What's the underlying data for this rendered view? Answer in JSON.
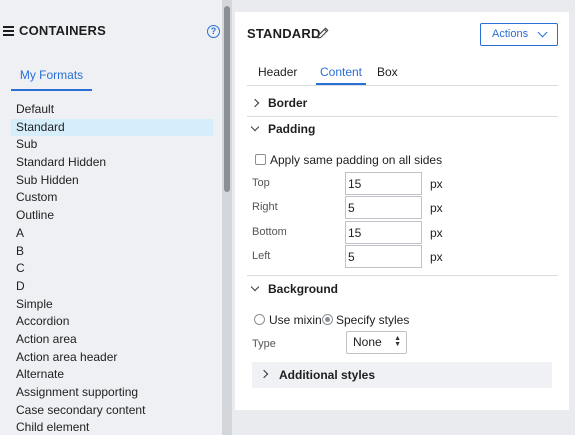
{
  "left_panel": {
    "title": "CONTAINERS",
    "help_icon": "?",
    "tab_label": "My Formats",
    "formats": [
      "Default",
      "Standard",
      "Sub",
      "Standard Hidden",
      "Sub Hidden",
      "Custom",
      "Outline",
      "A",
      "B",
      "C",
      "D",
      "Simple",
      "Accordion",
      "Action area",
      "Action area header",
      "Alternate",
      "Assignment supporting",
      "Case secondary content",
      "Child element"
    ],
    "selected_format": "Standard"
  },
  "detail": {
    "title": "STANDARD",
    "actions_label": "Actions",
    "tabs": [
      "Header",
      "Content",
      "Box"
    ],
    "active_tab": "Content",
    "sections": {
      "border": "Border",
      "padding": "Padding",
      "background": "Background"
    },
    "padding": {
      "same_all_label": "Apply same padding on all sides",
      "same_all_checked": false,
      "rows": [
        {
          "label": "Top",
          "value": "15",
          "unit": "px"
        },
        {
          "label": "Right",
          "value": "5",
          "unit": "px"
        },
        {
          "label": "Bottom",
          "value": "15",
          "unit": "px"
        },
        {
          "label": "Left",
          "value": "5",
          "unit": "px"
        }
      ]
    },
    "background": {
      "option_mixin": "Use mixin",
      "option_specify": "Specify styles",
      "selected_option": "Specify styles",
      "type_label": "Type",
      "type_value": "None",
      "additional_styles": "Additional styles"
    }
  },
  "colors": {
    "accent": "#2a6fd6",
    "selected_row": "#d6eefb"
  }
}
